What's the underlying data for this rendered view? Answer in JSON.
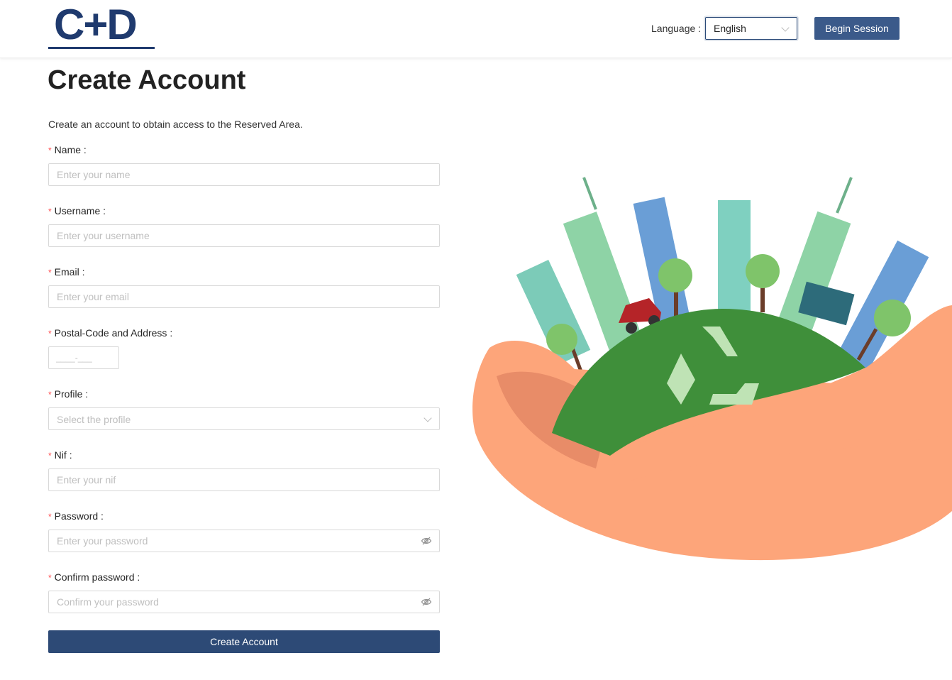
{
  "header": {
    "logo_text": "C+D",
    "language_label": "Language",
    "language_value": "English",
    "begin_session_label": "Begin Session"
  },
  "page": {
    "title": "Create Account",
    "subtitle": "Create an account to obtain access to the Reserved Area."
  },
  "form": {
    "name": {
      "label": "Name",
      "placeholder": "Enter your name"
    },
    "username": {
      "label": "Username",
      "placeholder": "Enter your username"
    },
    "email": {
      "label": "Email",
      "placeholder": "Enter your email"
    },
    "postal": {
      "label": "Postal-Code and Address",
      "placeholder": "____-___"
    },
    "profile": {
      "label": "Profile",
      "placeholder": "Select the profile"
    },
    "nif": {
      "label": "Nif",
      "placeholder": "Enter your nif"
    },
    "password": {
      "label": "Password",
      "placeholder": "Enter your password"
    },
    "confirm_password": {
      "label": "Confirm password",
      "placeholder": "Confirm your password"
    },
    "required_mark": "*",
    "label_suffix": ":",
    "submit_label": "Create Account"
  },
  "icons": {
    "language_dropdown": "chevron-down-icon",
    "profile_dropdown": "chevron-down-icon",
    "password_toggle": "eye-invisible-icon",
    "confirm_toggle": "eye-invisible-icon"
  },
  "colors": {
    "brand": "#1f3a6e",
    "primary_button": "#2d4a76",
    "secondary_button": "#3b5a8a",
    "required": "#ff4d4f"
  }
}
